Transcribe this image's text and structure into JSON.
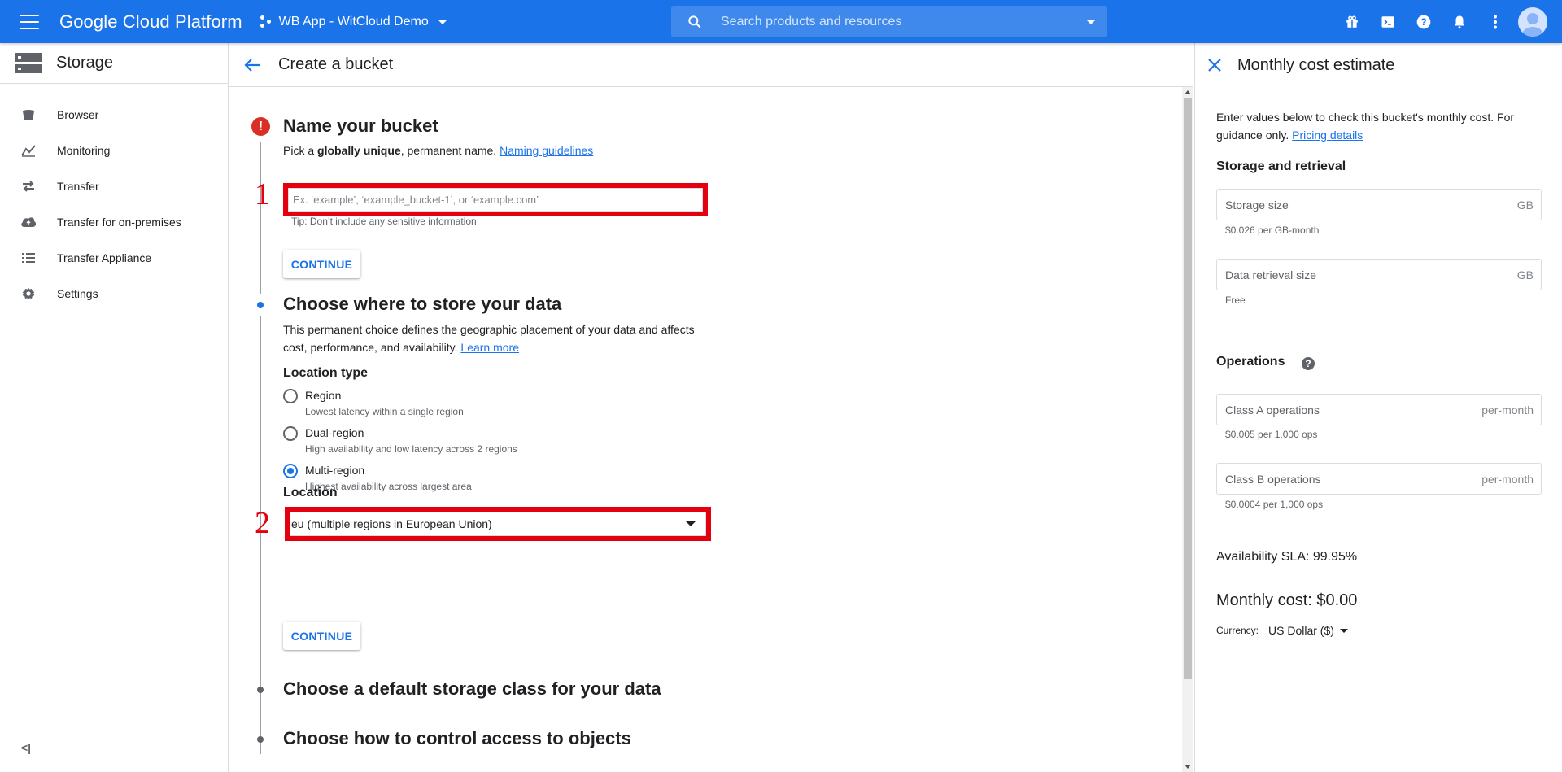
{
  "topbar": {
    "brand": "Google Cloud Platform",
    "project": "WB App - WitCloud Demo",
    "search_placeholder": "Search products and resources"
  },
  "leftnav": {
    "title": "Storage",
    "items": [
      {
        "label": "Browser",
        "icon": "bucket-icon"
      },
      {
        "label": "Monitoring",
        "icon": "chart-icon"
      },
      {
        "label": "Transfer",
        "icon": "transfer-icon"
      },
      {
        "label": "Transfer for on-premises",
        "icon": "cloud-upload-icon"
      },
      {
        "label": "Transfer Appliance",
        "icon": "appliance-icon"
      },
      {
        "label": "Settings",
        "icon": "gear-icon"
      }
    ],
    "collapse": "<|"
  },
  "main": {
    "title": "Create a bucket",
    "step1": {
      "title": "Name your bucket",
      "desc_pre": "Pick a ",
      "desc_bold": "globally unique",
      "desc_post": ", permanent name. ",
      "link": "Naming guidelines",
      "input_placeholder": "Ex. ‘example’, ‘example_bucket-1’, or ‘example.com’",
      "input_value": "",
      "tip": "Tip: Don’t include any sensitive information",
      "continue": "CONTINUE",
      "marker": "1"
    },
    "step2": {
      "title": "Choose where to store your data",
      "desc_l1": "This permanent choice defines the geographic placement of your data and affects",
      "desc_l2": "cost, performance, and availability. ",
      "link": "Learn more",
      "location_type_label": "Location type",
      "options": [
        {
          "label": "Region",
          "desc": "Lowest latency within a single region",
          "selected": false
        },
        {
          "label": "Dual-region",
          "desc": "High availability and low latency across 2 regions",
          "selected": false
        },
        {
          "label": "Multi-region",
          "desc": "Highest availability across largest area",
          "selected": true
        }
      ],
      "location_label": "Location",
      "location_value": "eu (multiple regions in European Union)",
      "continue": "CONTINUE",
      "marker": "2"
    },
    "step3": {
      "title": "Choose a default storage class for your data"
    },
    "step4": {
      "title": "Choose how to control access to objects"
    }
  },
  "rpanel": {
    "title": "Monthly cost estimate",
    "intro_l1": "Enter values below to check this bucket's monthly cost. For",
    "intro_l2": "guidance only. ",
    "pricing_link": "Pricing details",
    "storage_heading": "Storage and retrieval",
    "storage_size": {
      "placeholder": "Storage size",
      "suffix": "GB",
      "hint": "$0.026 per GB-month"
    },
    "retrieval_size": {
      "placeholder": "Data retrieval size",
      "suffix": "GB",
      "hint": "Free"
    },
    "operations_heading": "Operations",
    "class_a": {
      "placeholder": "Class A operations",
      "suffix": "per-month",
      "hint": "$0.005 per 1,000 ops"
    },
    "class_b": {
      "placeholder": "Class B operations",
      "suffix": "per-month",
      "hint": "$0.0004 per 1,000 ops"
    },
    "sla": "Availability SLA: 99.95%",
    "monthly_cost": "Monthly cost: $0.00",
    "currency_label": "Currency:",
    "currency_value": "US Dollar ($)"
  },
  "colors": {
    "brand_blue": "#1a73e8",
    "error_red": "#d93025",
    "annotation_red": "#e4000f"
  }
}
